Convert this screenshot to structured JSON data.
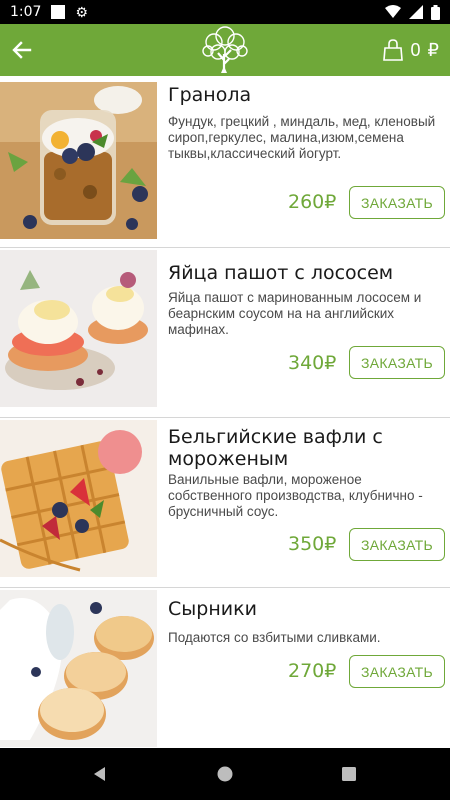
{
  "status": {
    "time": "1:07"
  },
  "app_bar": {
    "cart_total": "0 ₽"
  },
  "colors": {
    "accent": "#6fa839",
    "text": "#1a1a1a",
    "muted": "#4a4a4a"
  },
  "menu": {
    "items": [
      {
        "title": "Гранола",
        "description": "Фундук, грецкий , миндаль, мед, кленовый сироп,геркулес, малина,изюм,семена тыквы,классический йогурт.",
        "price": "260₽",
        "order_label": "ЗАКАЗАТЬ"
      },
      {
        "title": "Яйца пашот с лососем",
        "description": "Яйца пашот с маринованным лососем и беарнским соусом на  на английских мафинах.",
        "price": "340₽",
        "order_label": "ЗАКАЗАТЬ"
      },
      {
        "title": "Бельгийские вафли с мороженым",
        "description": "Ванильные вафли, мороженое собственного производства, клубнично - брусничный соус.",
        "price": "350₽",
        "order_label": "ЗАКАЗАТЬ"
      },
      {
        "title": "Сырники",
        "description": "Подаются со взбитыми сливками.",
        "price": "270₽",
        "order_label": "ЗАКАЗАТЬ"
      }
    ]
  }
}
